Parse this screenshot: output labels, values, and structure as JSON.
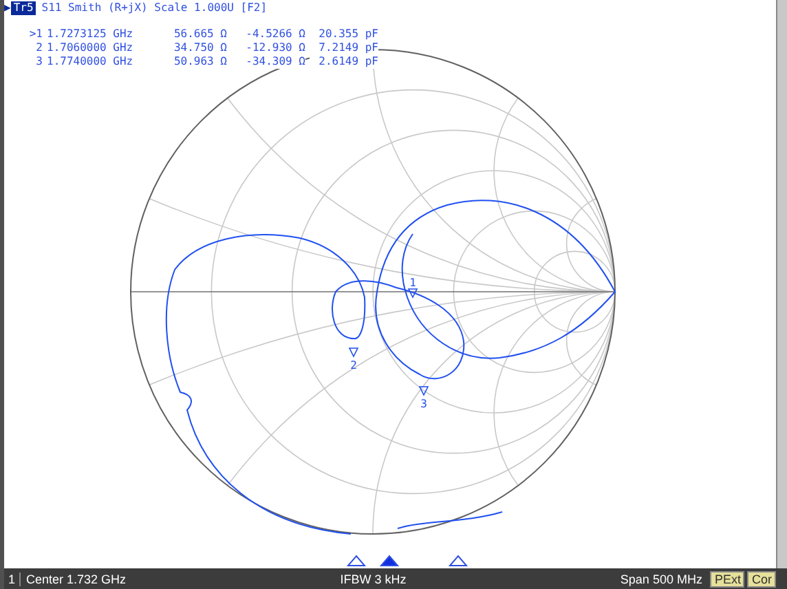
{
  "trace": {
    "pointer": "▶",
    "id": "Tr5",
    "title": "S11 Smith (R+jX) Scale 1.000U [F2]"
  },
  "marker_table": [
    {
      "label": ">1",
      "frequency": "1.7273125 GHz",
      "resistance": "56.665 Ω",
      "reactance": "-4.5266 Ω",
      "component": "20.355 pF"
    },
    {
      "label": "2",
      "frequency": "1.7060000 GHz",
      "resistance": "34.750 Ω",
      "reactance": "-12.930 Ω",
      "component": "7.2149 pF"
    },
    {
      "label": "3",
      "frequency": "1.7740000 GHz",
      "resistance": "50.963 Ω",
      "reactance": "-34.309 Ω",
      "component": "2.6149 pF"
    }
  ],
  "chart_markers": [
    "1",
    "2",
    "3"
  ],
  "stimulus_markers": [
    {
      "selected": false
    },
    {
      "selected": true
    },
    {
      "selected": false
    }
  ],
  "status_bar": {
    "channel": "1",
    "center": "Center 1.732 GHz",
    "ifbw": "IFBW 3 kHz",
    "span": "Span 500 MHz",
    "flags": [
      "PExt",
      "Cor"
    ]
  }
}
